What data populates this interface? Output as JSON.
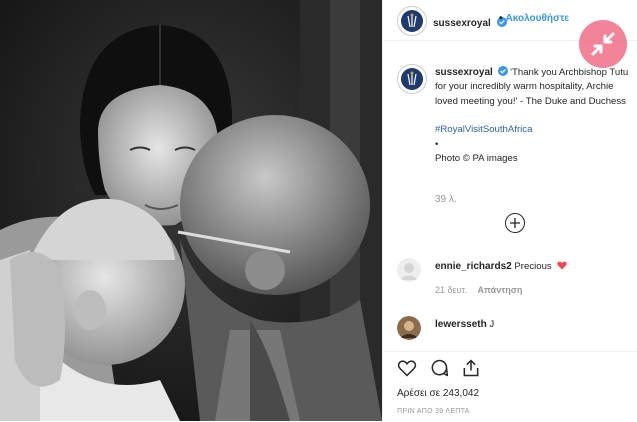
{
  "photo": {
    "alt": ""
  },
  "header": {
    "username": "sussexroyal",
    "follow_separator": "•",
    "follow_label": "Ακολουθήστε"
  },
  "caption": {
    "username": "sussexroyal",
    "text": "'Thank you Archbishop Tutu for your incredibly warm hospitality, Archie loved meeting you!' - The Duke and Duchess",
    "hashtag": "#RoyalVisitSouthAfrica",
    "bullet": "•",
    "credit": "Photo © PA images",
    "age": "39 λ."
  },
  "comments": [
    {
      "username": "ennie_richards2",
      "text": "Precious",
      "time": "21 δευτ.",
      "reply": "Απάντηση"
    },
    {
      "username": "lewersseth",
      "text": "J",
      "time": "",
      "reply": ""
    }
  ],
  "footer": {
    "likes": "Αρέσει σε 243,042",
    "time_ago": "ΠΡΙΝ ΑΠΟ 39 ΛΕΠΤΑ"
  },
  "colors": {
    "accent": "#3897f0",
    "collapse": "#f06e87",
    "heart": "#ed4956"
  }
}
